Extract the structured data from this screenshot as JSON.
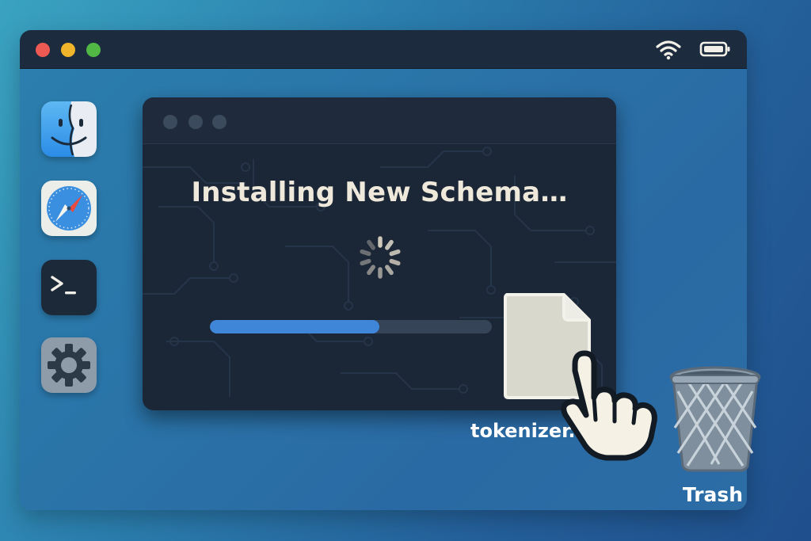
{
  "menubar": {
    "traffic_lights": [
      "close",
      "minimize",
      "zoom"
    ],
    "status_icons": [
      "wifi-icon",
      "battery-icon"
    ]
  },
  "dock": {
    "items": [
      {
        "name": "finder",
        "icon": "finder-icon"
      },
      {
        "name": "safari",
        "icon": "compass-icon"
      },
      {
        "name": "terminal",
        "icon": "terminal-icon"
      },
      {
        "name": "settings",
        "icon": "gear-icon"
      }
    ]
  },
  "installer": {
    "title": "Installing New Schema…",
    "progress": 0.6
  },
  "desktop": {
    "file_label": "tokenizer.json",
    "trash_label": "Trash"
  },
  "colors": {
    "accent": "#3f86d8",
    "window_bg": "#1b2636",
    "text_light": "#efe9dc"
  }
}
